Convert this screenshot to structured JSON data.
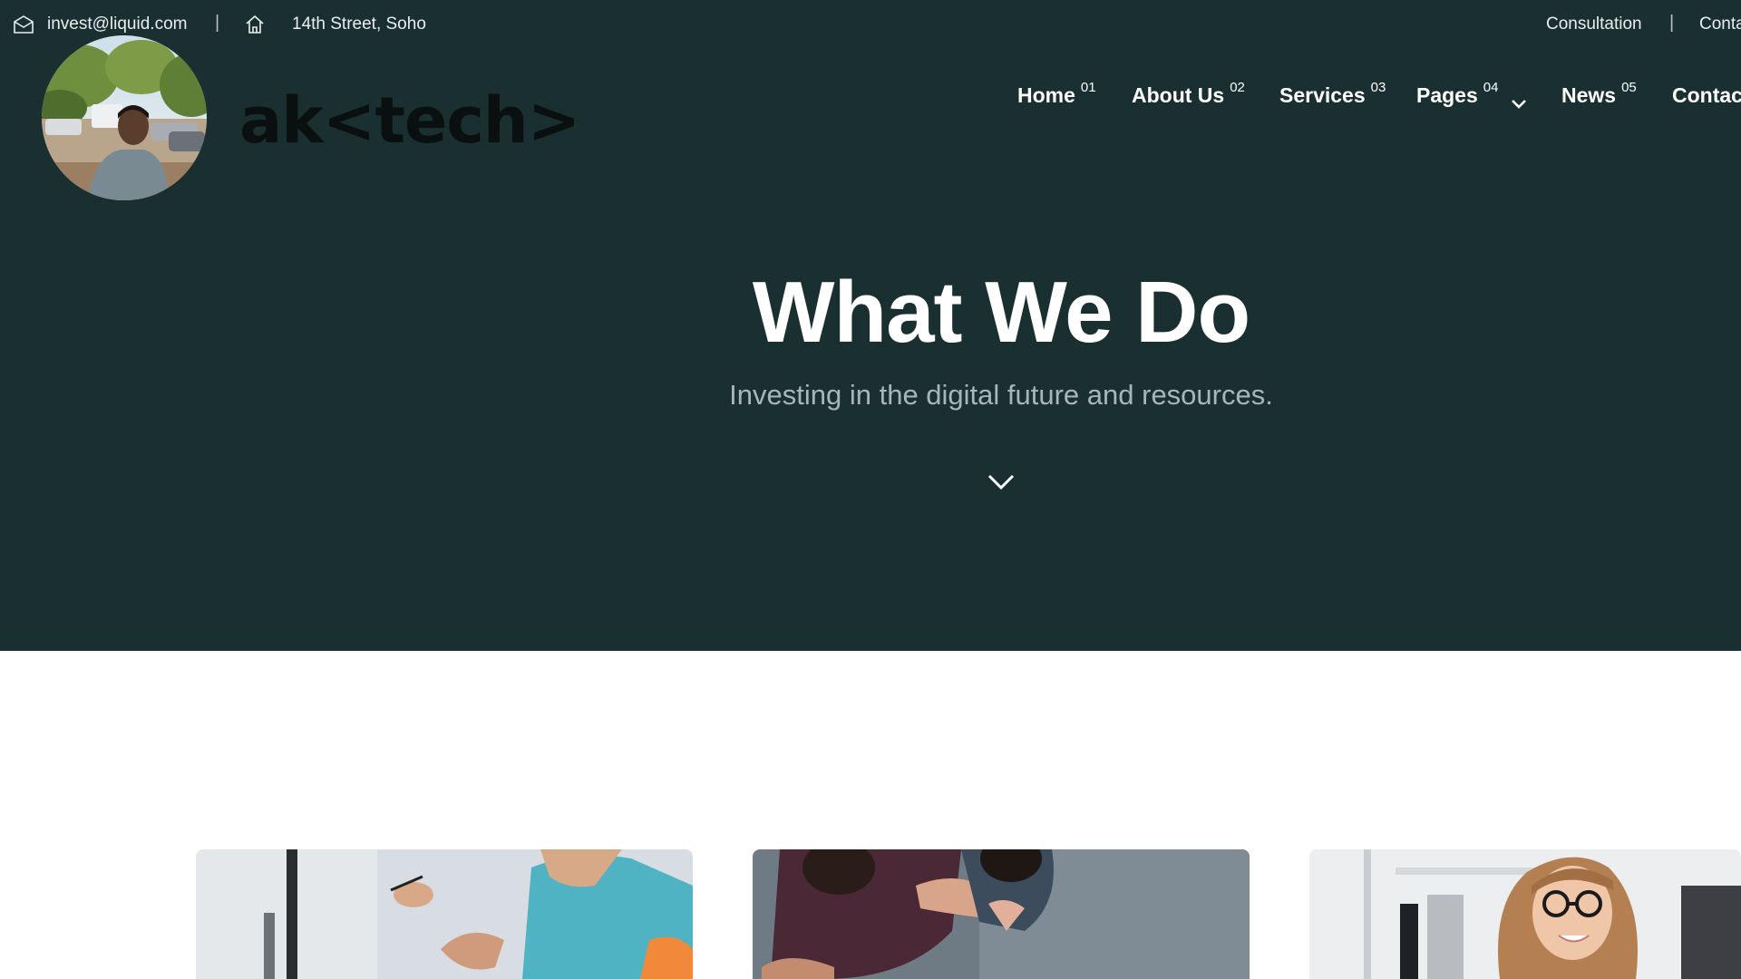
{
  "topbar": {
    "email": "invest@liquid.com",
    "address": "14th Street, Soho",
    "consultation": "Consultation",
    "contact_short": "Conta",
    "separator": "|"
  },
  "brand": {
    "logo_text": "ak<tech>"
  },
  "nav": {
    "items": [
      {
        "label": "Home",
        "num": "01"
      },
      {
        "label": "About Us",
        "num": "02"
      },
      {
        "label": "Services",
        "num": "03"
      },
      {
        "label": "Pages",
        "num": "04"
      },
      {
        "label": "News",
        "num": "05"
      },
      {
        "label": "Contac",
        "num": ""
      }
    ]
  },
  "hero": {
    "title": "What We Do",
    "subtitle": "Investing in the digital future and resources."
  },
  "colors": {
    "hero_bg": "#1a2f2f",
    "text_light": "#ffffff",
    "subtitle": "#a9b6b6",
    "brand_text": "#0a0f0f"
  }
}
